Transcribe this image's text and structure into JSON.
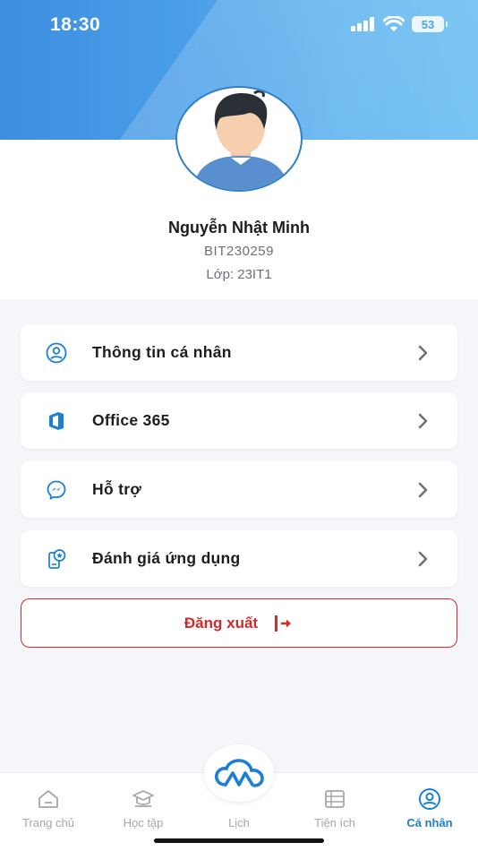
{
  "status": {
    "time": "18:30",
    "battery": "53"
  },
  "profile": {
    "name": "Nguyễn Nhật Minh",
    "student_id": "BIT230259",
    "class": "Lớp: 23IT1"
  },
  "menu": [
    {
      "label": "Thông tin cá nhân",
      "icon": "user-circle-icon"
    },
    {
      "label": "Office 365",
      "icon": "office-icon"
    },
    {
      "label": "Hỗ trợ",
      "icon": "messenger-icon"
    },
    {
      "label": "Đánh giá ứng dụng",
      "icon": "rate-app-icon"
    }
  ],
  "logout": {
    "label": "Đăng xuất"
  },
  "tabs": [
    {
      "label": "Trang chủ",
      "icon": "home-icon"
    },
    {
      "label": "Học tập",
      "icon": "graduation-cap-icon"
    },
    {
      "label": "Lịch",
      "icon": "cloud-logo-icon"
    },
    {
      "label": "Tiện ích",
      "icon": "utilities-icon"
    },
    {
      "label": "Cá nhân",
      "icon": "profile-icon",
      "active": true
    }
  ],
  "colors": {
    "accent": "#1c7fd6",
    "danger": "#d02c2c",
    "header": "#4a9fe8"
  }
}
